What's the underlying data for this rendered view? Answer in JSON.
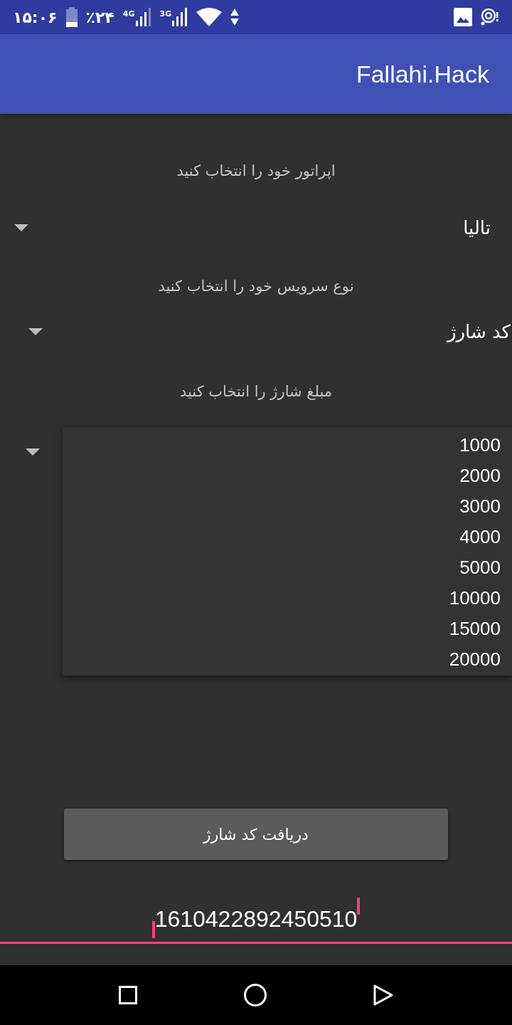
{
  "status_bar": {
    "time": "۱۵:۰۶",
    "battery": "٪۲۴",
    "network_1": "4G",
    "network_2": "3G"
  },
  "app_bar": {
    "title": "Fallahi.Hack"
  },
  "operator": {
    "label": "اپراتور خود را انتخاب کنید",
    "value": "تالیا"
  },
  "service": {
    "label": "نوع سرویس خود را انتخاب کنید",
    "value": "کد شارژ"
  },
  "amount": {
    "label": "مبلغ شارژ را انتخاب کنید",
    "expanded": true,
    "options": [
      "1000",
      "2000",
      "3000",
      "4000",
      "5000",
      "10000",
      "15000",
      "20000"
    ]
  },
  "button": "دریافت کد شارژ",
  "code_field": {
    "value": "1610422892450510"
  }
}
